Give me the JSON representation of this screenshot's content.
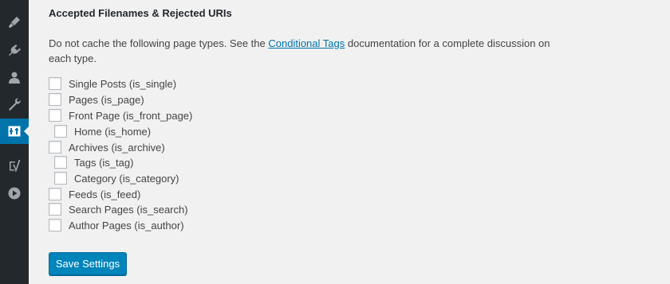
{
  "section": {
    "title": "Accepted Filenames & Rejected URIs",
    "desc_before": "Do not cache the following page types. See the ",
    "desc_link": "Conditional Tags",
    "desc_after": " documentation for a complete discussion on each type."
  },
  "options": [
    {
      "label": "Single Posts (is_single)",
      "checked": false
    },
    {
      "label": "Pages (is_page)",
      "checked": false
    },
    {
      "label": "Front Page (is_front_page)",
      "checked": false
    },
    {
      "label": "Home (is_home)",
      "checked": false
    },
    {
      "label": "Archives (is_archive)",
      "checked": false
    },
    {
      "label": "Tags (is_tag)",
      "checked": false
    },
    {
      "label": "Category (is_category)",
      "checked": false
    },
    {
      "label": "Feeds (is_feed)",
      "checked": false
    },
    {
      "label": "Search Pages (is_search)",
      "checked": false
    },
    {
      "label": "Author Pages (is_author)",
      "checked": false
    }
  ],
  "save_button": "Save Settings",
  "sidebar": {
    "icons": [
      "appearance-icon",
      "plugins-icon",
      "users-icon",
      "tools-icon",
      "settings-icon",
      "yoast-seo-icon",
      "media-play-icon"
    ],
    "active": "settings-icon"
  },
  "colors": {
    "sidebar_bg": "#23282d",
    "sidebar_icon": "#a0a5aa",
    "accent": "#0073aa",
    "button": "#0085ba",
    "page_bg": "#f1f1f1"
  }
}
